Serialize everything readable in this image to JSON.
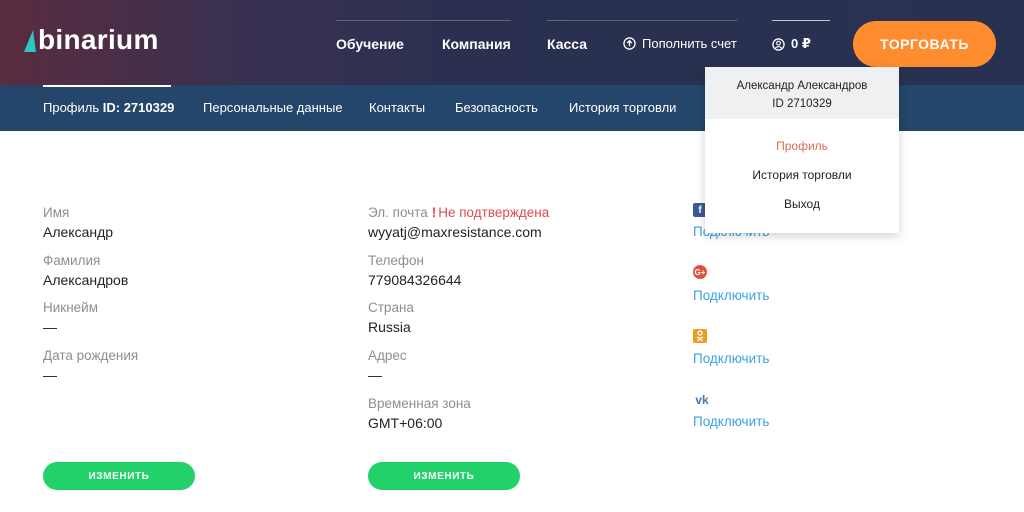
{
  "header": {
    "logo_text": "binarium",
    "nav": [
      "Обучение",
      "Компания",
      "Касса"
    ],
    "deposit_label": "Пополнить счет",
    "balance": "0 ₽",
    "trade_button": "ТОРГОВАТЬ"
  },
  "subnav": {
    "profile_prefix": "Профиль",
    "profile_id": "ID: 2710329",
    "items": [
      "Персональные данные",
      "Контакты",
      "Безопасность",
      "История торговли"
    ]
  },
  "personal": {
    "name_label": "Имя",
    "name_value": "Александр",
    "surname_label": "Фамилия",
    "surname_value": "Александров",
    "nickname_label": "Никнейм",
    "nickname_value": "—",
    "birthdate_label": "Дата рождения",
    "birthdate_value": "—",
    "edit_button": "ИЗМЕНИТЬ"
  },
  "contacts": {
    "email_label": "Эл. почта",
    "email_status": "Не подтверждена",
    "email_value": "wyyatj@maxresistance.com",
    "phone_label": "Телефон",
    "phone_value": "779084326644",
    "country_label": "Страна",
    "country_value": "Russia",
    "address_label": "Адрес",
    "address_value": "—",
    "timezone_label": "Временная зона",
    "timezone_value": "GMT+06:00",
    "edit_button": "ИЗМЕНИТЬ"
  },
  "social": {
    "connect_label": "Подключить",
    "networks": [
      {
        "icon": "facebook-icon",
        "color": "#3b5998"
      },
      {
        "icon": "google-plus-icon",
        "color": "#e0523e"
      },
      {
        "icon": "odnoklassniki-icon",
        "color": "#f39a1e"
      },
      {
        "icon": "vk-icon",
        "color": "#4a76a8"
      }
    ]
  },
  "dropdown": {
    "user_name": "Александр Александров",
    "user_id": "ID 2710329",
    "items": [
      "Профиль",
      "История торговли",
      "Выход"
    ]
  },
  "colors": {
    "accent_orange": "#ff8c2e",
    "subnav_bg": "#24466a",
    "edit_green": "#23d16b",
    "link_blue": "#3aa4e0",
    "warning_red": "#e14b4b"
  }
}
